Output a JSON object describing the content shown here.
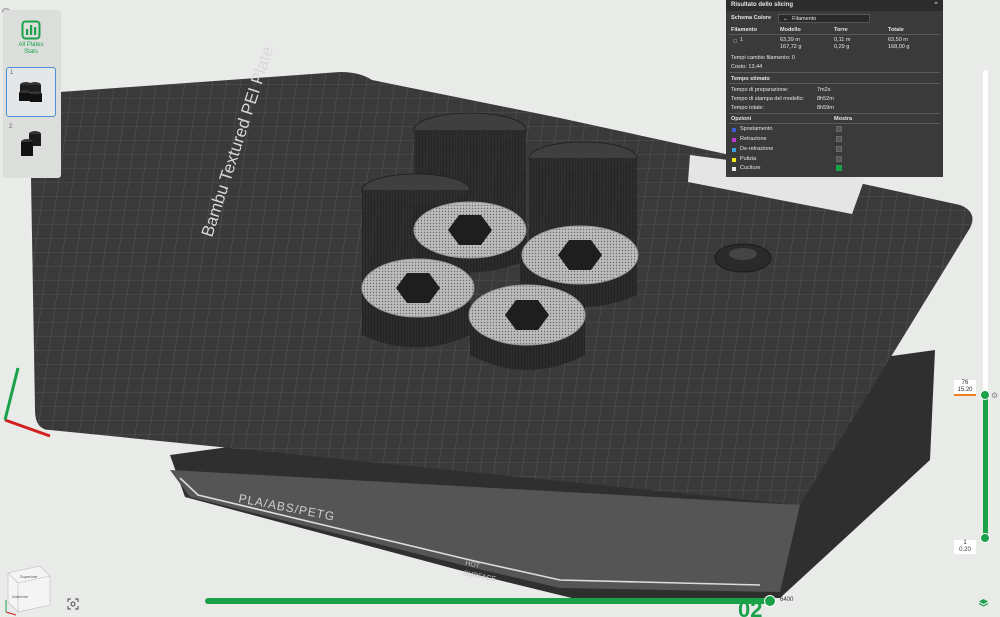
{
  "plate_panel": {
    "stats_label_line1": "All Plates",
    "stats_label_line2": "Stats",
    "plates": [
      {
        "number": "1",
        "selected": true
      },
      {
        "number": "2",
        "selected": false
      }
    ]
  },
  "bed": {
    "brand_text": "Bambu Textured PEI Plate",
    "filament_text": "PLA/ABS/PETG",
    "hot_surface_line1": "HOT",
    "hot_surface_line2": "SURFACE",
    "corner_number": "02"
  },
  "slicing_result": {
    "title": "Risultato dello slicing",
    "color_scheme_label": "Schema Colore",
    "color_scheme_value": "Filamento",
    "columns": [
      "Filamento",
      "Modello",
      "Torre",
      "Totale"
    ],
    "filament_row": {
      "id": "1",
      "model_length": "63,39 m",
      "model_weight": "167,72 g",
      "tower_length": "0,11 m",
      "tower_weight": "0,29 g",
      "total_length": "63,50 m",
      "total_weight": "168,00 g"
    },
    "filament_changes": "Tempi cambio filamento:   0",
    "cost": "Costo:   13,44",
    "time_section": "Tempo stimato",
    "times": [
      {
        "label": "Tempo di preparazione:",
        "value": "7m2s"
      },
      {
        "label": "Tempo di stampa del modello:",
        "value": "8h52m"
      },
      {
        "label": "Tempo totale:",
        "value": "8h59m"
      }
    ],
    "options_header": "Opzioni",
    "show_header": "Mostra",
    "options": [
      {
        "label": "Spostamento",
        "color": "#3f5fd6",
        "checked": false
      },
      {
        "label": "Retrazione",
        "color": "#c03bd4",
        "checked": false
      },
      {
        "label": "De-retrazione",
        "color": "#3fa1e0",
        "checked": false
      },
      {
        "label": "Pulizia",
        "color": "#f2e619",
        "checked": false
      },
      {
        "label": "Cuciture",
        "color": "#e6e6e6",
        "checked": true
      }
    ]
  },
  "layer_slider": {
    "top_layer": "76",
    "top_height": "15.20",
    "bottom_layer": "1",
    "bottom_height": "0.20"
  },
  "move_slider": {
    "value": "6400"
  },
  "accent_color": "#1aa14a"
}
